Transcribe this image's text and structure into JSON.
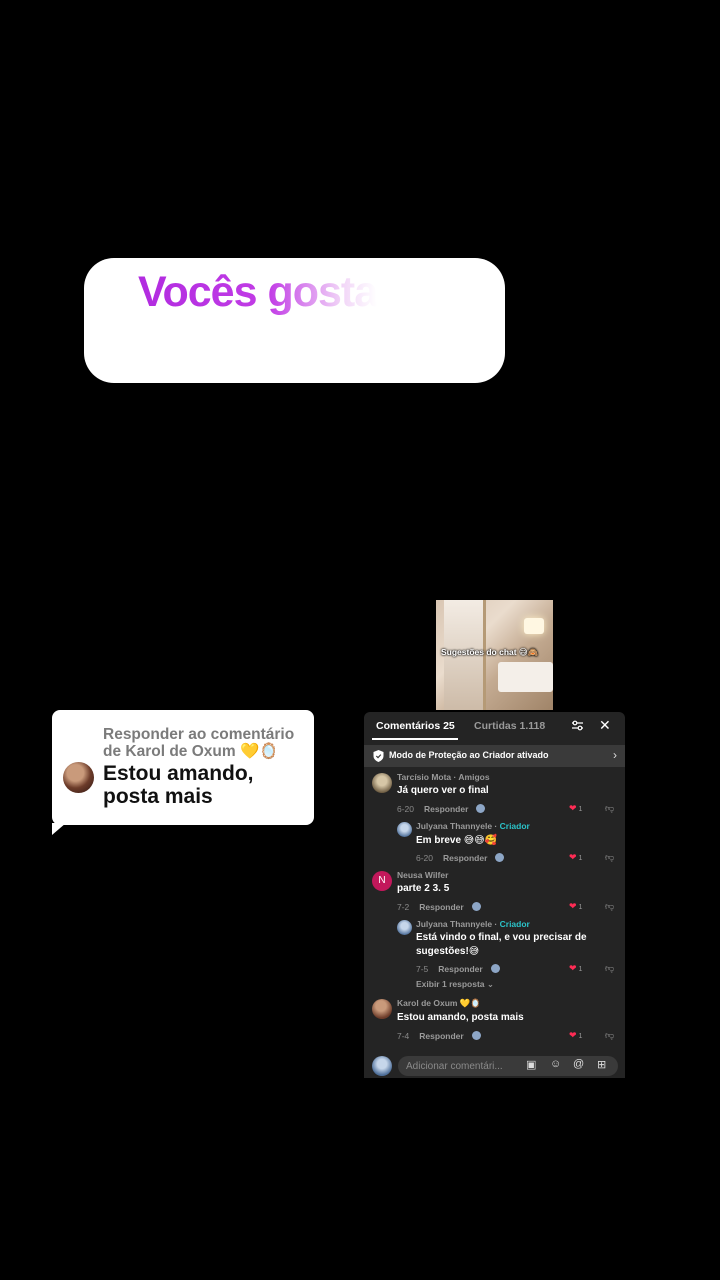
{
  "caption": {
    "text": "Vocês gosta"
  },
  "reply_bubble": {
    "header": "Responder ao comentário de Karol de Oxum 💛🪞",
    "body": "Estou amando, posta mais"
  },
  "thumbnail": {
    "overlay_text": "Sugestões do chat 😅🙈"
  },
  "panel": {
    "tabs": {
      "comments": "Comentários 25",
      "likes": "Curtidas 1.118"
    },
    "protection_text": "Modo de Proteção ao Criador ativado",
    "comments": [
      {
        "name": "Tarcísio Mota · Amigos",
        "text": "Já quero ver o final",
        "date": "6-20",
        "reply": "Responder",
        "likes": "1"
      },
      {
        "name": "Julyana Thannyele · ",
        "creator": "Criador",
        "text": "Em breve 😅😅🥰",
        "date": "6-20",
        "reply": "Responder",
        "likes": "1"
      },
      {
        "name": "Neusa Wilfer",
        "avatar_letter": "N",
        "text": "parte 2 3. 5",
        "date": "7-2",
        "reply": "Responder",
        "likes": "1"
      },
      {
        "name": "Julyana Thannyele · ",
        "creator": "Criador",
        "text": "Está vindo o final, e vou precisar de sugestões!😅",
        "date": "7-5",
        "reply": "Responder",
        "likes": "1",
        "view_replies": "Exibir 1 resposta ⌄"
      },
      {
        "name": "Karol de Oxum 💛🪞",
        "text": "Estou amando, posta mais",
        "date": "7-4",
        "reply": "Responder",
        "likes": "1"
      }
    ],
    "input_placeholder": "Adicionar comentári..."
  },
  "colors": {
    "background": "#000000",
    "panel": "#242424",
    "like": "#fe2c55",
    "creator": "#2bc3c9",
    "caption_gradient_start": "#b12be0"
  }
}
